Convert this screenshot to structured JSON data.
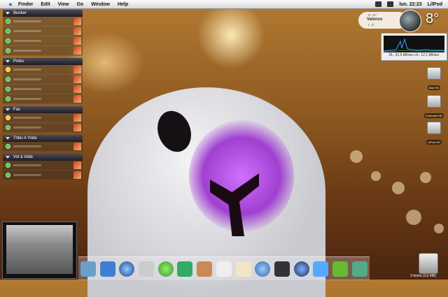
{
  "menubar": {
    "app": "Finder",
    "menus": [
      "Edit",
      "View",
      "Go",
      "Window",
      "Help"
    ],
    "clock": "lun. 22:23",
    "user": "LilPod"
  },
  "buddy_list": {
    "groups": [
      {
        "name": "Bunker",
        "buddies": 4
      },
      {
        "name": "Potes",
        "buddies": 4
      },
      {
        "name": "Fac",
        "buddies": 2
      },
      {
        "name": "Tribu A Yoda",
        "buddies": 1
      },
      {
        "name": "Vol à Voile",
        "buddies": 2
      }
    ]
  },
  "weather": {
    "city": "Valence",
    "high": "H: 12°",
    "low": "L: 6°",
    "temperature": "8°"
  },
  "network": {
    "readout": "DL: 31,9 kB/sec  UL: 12,1 kB/sec"
  },
  "drives": [
    "Mac HD",
    "Extended HD",
    "LilPod HD"
  ],
  "dock": {
    "icons": [
      "dashboard-icon",
      "finder-icon",
      "sherlock-icon",
      "system-prefs-icon",
      "itunes-icon",
      "feather-icon",
      "iphoto-icon",
      "preview-icon",
      "textedit-icon",
      "safari-icon",
      "adium-icon",
      "quicktime-icon",
      "ical-icon",
      "frog-icon",
      "bomb-icon"
    ]
  },
  "status": {
    "trash_items": "3 Items (3,6 MB)"
  },
  "colors": {
    "accent_green": "#3bd14a",
    "accent_yellow": "#f3d02a",
    "cheek_purple": "#c060f0"
  }
}
